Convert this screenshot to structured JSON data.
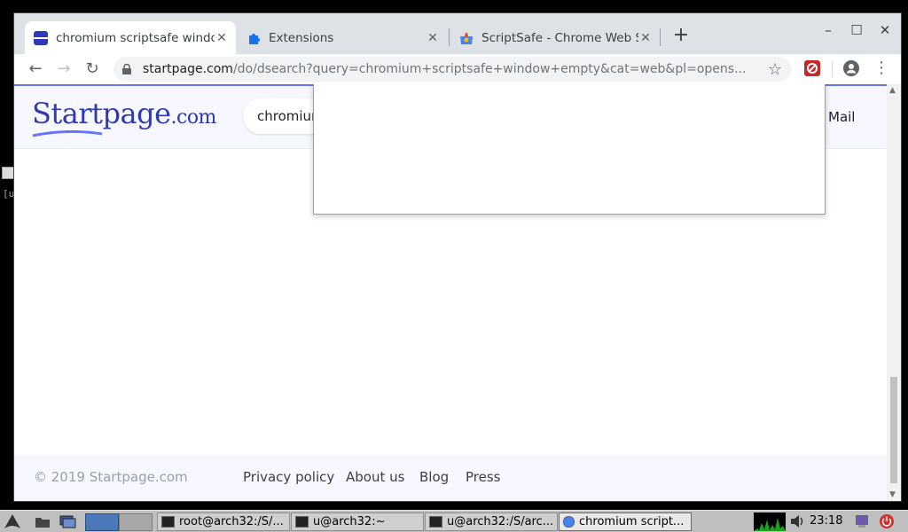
{
  "browser": {
    "tabs": [
      {
        "title": "chromium scriptsafe windo",
        "active": true,
        "favicon": "startpage-favicon"
      },
      {
        "title": "Extensions",
        "active": false,
        "favicon": "puzzle-piece-icon"
      },
      {
        "title": "ScriptSafe - Chrome Web S",
        "active": false,
        "favicon": "chrome-web-store-icon"
      }
    ],
    "new_tab_symbol": "+",
    "window_controls": {
      "minimize": "–",
      "maximize": "☐",
      "close": "✕"
    },
    "nav": {
      "back": "←",
      "forward": "→",
      "reload": "↻"
    },
    "url": {
      "host": "startpage.com",
      "path": "/do/dsearch?query=chromium+scriptsafe+window+empty&cat=web&pl=opens..."
    },
    "star_symbol": "☆",
    "menu_symbol": "⋮"
  },
  "page": {
    "logo": {
      "main": "Startpage",
      "suffix": ".com"
    },
    "search_text": "chromium",
    "mail_link": "Mail",
    "footer": {
      "copyright": "© 2019 Startpage.com",
      "links": [
        "Privacy policy",
        "About us",
        "Blog",
        "Press"
      ]
    }
  },
  "taskbar": {
    "tasks": [
      {
        "label": "root@arch32:/S/...",
        "active": false
      },
      {
        "label": "u@arch32:~",
        "active": false
      },
      {
        "label": "u@arch32:/S/arc...",
        "active": false
      },
      {
        "label": "chromium script...",
        "active": true
      }
    ],
    "clock": "23:18"
  },
  "colors": {
    "accent": "#6573ff",
    "startpage_brand": "#2e39b3",
    "extension_red": "#c62828"
  }
}
